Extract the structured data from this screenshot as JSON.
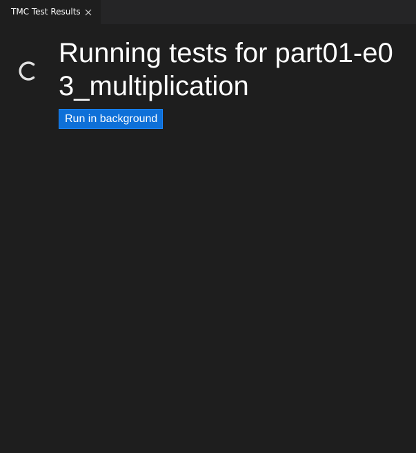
{
  "tab": {
    "label": "TMC Test Results",
    "close_icon": "close-icon"
  },
  "main": {
    "spinner_icon": "loading-spinner-icon",
    "title": "Running tests for part01-e03_multiplication",
    "run_background_label": "Run in background"
  },
  "colors": {
    "background": "#1e1e1e",
    "tab_bar": "#252526",
    "button_accent": "#0e70d8",
    "text": "#ffffff"
  }
}
